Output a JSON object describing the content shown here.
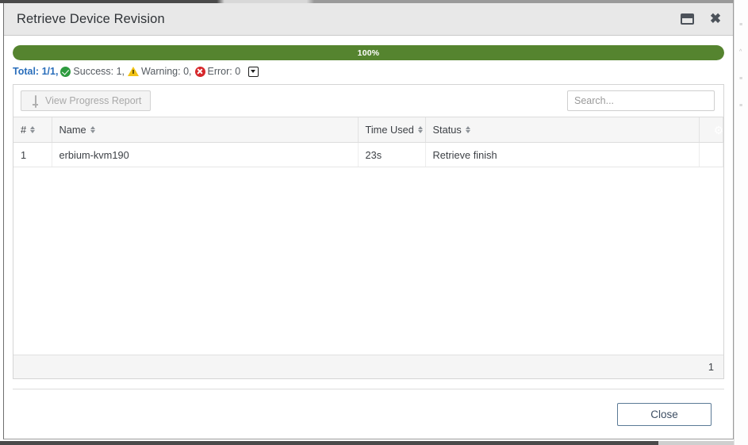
{
  "window": {
    "title": "Retrieve Device Revision",
    "restore_icon": "restore-window-icon",
    "close_icon": "close-window-icon"
  },
  "progress": {
    "percent": 100,
    "label": "100%",
    "bar_color": "#55842f"
  },
  "summary": {
    "total_label": "Total: 1/1,",
    "success_icon": "success-check-icon",
    "success_label": "Success: 1,",
    "warning_icon": "warning-triangle-icon",
    "warning_label": "Warning: 0,",
    "error_icon": "error-x-icon",
    "error_label": "Error: 0",
    "collapse_icon": "collapse-toggle-icon",
    "total_color": "#2a6ebb",
    "success_color": "#2e9b3f",
    "warning_color": "#f2c316",
    "error_color": "#d6272b"
  },
  "toolbar": {
    "progress_report_label": "View Progress Report",
    "progress_report_icon": "monitor-icon",
    "progress_report_disabled": true,
    "search_placeholder": "Search...",
    "search_value": ""
  },
  "table": {
    "columns": [
      {
        "label": "#",
        "sortable": true
      },
      {
        "label": "Name",
        "sortable": true
      },
      {
        "label": "Time Used",
        "sortable": true
      },
      {
        "label": "Status",
        "sortable": true
      }
    ],
    "settings_icon": "gear-icon",
    "settings_color": "#3579bf",
    "rows": [
      {
        "index": "1",
        "name": "erbium-kvm190",
        "time_used": "23s",
        "status": "Retrieve finish"
      }
    ],
    "footer_count": "1"
  },
  "footer": {
    "close_label": "Close"
  }
}
